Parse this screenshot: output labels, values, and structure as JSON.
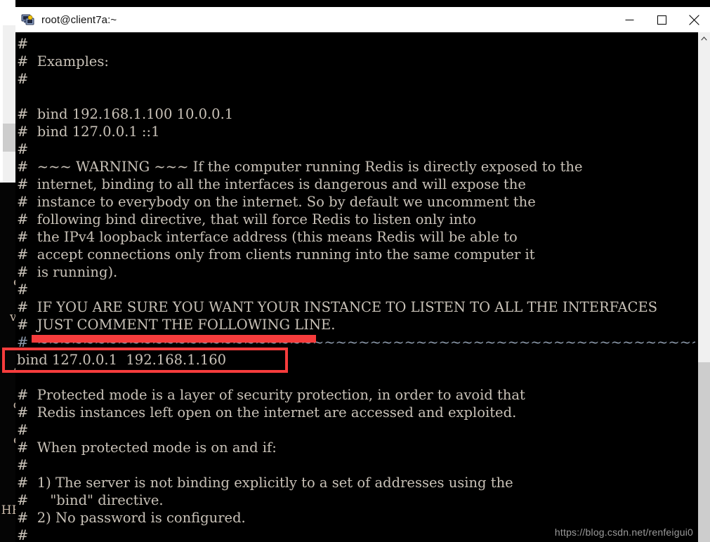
{
  "window": {
    "title": "root@client7a:~",
    "icon": "terminal-computer-icon",
    "controls": [
      {
        "name": "minimize",
        "glyph": "—"
      },
      {
        "name": "maximize",
        "glyph": "□"
      },
      {
        "name": "close",
        "glyph": "✕"
      }
    ]
  },
  "background_terminal": {
    "fragments": "\n\n\n\n\n\nre\n\n\n\n\n\n\n\ne\n\nvi\n\n\nc\n\no\nl\ne\n\n\n\nHE\n\n~\n"
  },
  "terminal": {
    "lines": [
      "#",
      "#  Examples:",
      "#",
      "",
      "#  bind 192.168.1.100 10.0.0.1",
      "#  bind 127.0.0.1 ::1",
      "#",
      "#  ~~~ WARNING ~~~ If the computer running Redis is directly exposed to the",
      "#  internet, binding to all the interfaces is dangerous and will expose the",
      "#  instance to everybody on the internet. So by default we uncomment the",
      "#  following bind directive, that will force Redis to listen only into",
      "#  the IPv4 loopback interface address (this means Redis will be able to",
      "#  accept connections only from clients running into the same computer it",
      "#  is running).",
      "#",
      "#  IF YOU ARE SURE YOU WANT YOUR INSTANCE TO LISTEN TO ALL THE INTERFACES",
      "#  JUST COMMENT THE FOLLOWING LINE.",
      "#  ~~~~~~~~~~~~~~~~~~~~~~~~~~~~~~~~~~~~~~~~~~~~~~~~~~~~~~~~~~~~~~~~~~~~~~~~~",
      "bind 127.0.0.1  192.168.1.160",
      "",
      "#  Protected mode is a layer of security protection, in order to avoid that",
      "#  Redis instances left open on the internet are accessed and exploited.",
      "#",
      "#  When protected mode is on and if:",
      "#",
      "#  1) The server is not binding explicitly to a set of addresses using the",
      "#     \"bind\" directive.",
      "#  2) No password is configured.",
      "#"
    ],
    "tilde_line_index": 17,
    "highlighted_line": "bind 127.0.0.1  192.168.1.160"
  },
  "annotations": {
    "underline_color": "#f63c3c",
    "box_color": "#f63c3c",
    "underline_label": "red-underline-over-tilde-line",
    "box_label": "red-box-around-bind-line"
  },
  "scrollbar": {
    "arrow_up": "▲",
    "thumb_label": "vertical-scroll-thumb"
  },
  "watermark": {
    "text": "https://blog.csdn.net/renfeigui0"
  }
}
